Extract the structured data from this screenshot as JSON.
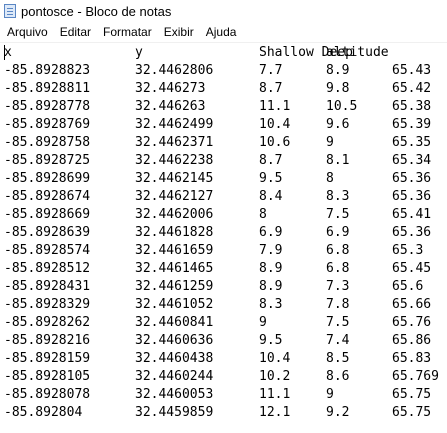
{
  "window": {
    "title": "pontosce - Bloco de notas",
    "icon": "notepad-icon"
  },
  "menu": [
    "Arquivo",
    "Editar",
    "Formatar",
    "Exibir",
    "Ajuda"
  ],
  "lines": [
    [
      "x",
      "y",
      "Shallow Deep",
      "altitude",
      ""
    ],
    [
      "-85.8928823",
      "32.4462806",
      "7.7",
      "8.9",
      "65.43"
    ],
    [
      "-85.8928811",
      "32.446273",
      "8.7",
      "9.8",
      "65.42"
    ],
    [
      "-85.8928778",
      "32.446263",
      "11.1",
      "10.5",
      "65.38"
    ],
    [
      "-85.8928769",
      "32.4462499",
      "10.4",
      "9.6",
      "65.39"
    ],
    [
      "-85.8928758",
      "32.4462371",
      "10.6",
      "9",
      "65.35"
    ],
    [
      "-85.8928725",
      "32.4462238",
      "8.7",
      "8.1",
      "65.34"
    ],
    [
      "-85.8928699",
      "32.4462145",
      "9.5",
      "8",
      "65.36"
    ],
    [
      "-85.8928674",
      "32.4462127",
      "8.4",
      "8.3",
      "65.36"
    ],
    [
      "-85.8928669",
      "32.4462006",
      "8",
      "7.5",
      "65.41"
    ],
    [
      "-85.8928639",
      "32.4461828",
      "6.9",
      "6.9",
      "65.36"
    ],
    [
      "-85.8928574",
      "32.4461659",
      "7.9",
      "6.8",
      "65.3"
    ],
    [
      "-85.8928512",
      "32.4461465",
      "8.9",
      "6.8",
      "65.45"
    ],
    [
      "-85.8928431",
      "32.4461259",
      "8.9",
      "7.3",
      "65.6"
    ],
    [
      "-85.8928329",
      "32.4461052",
      "8.3",
      "7.8",
      "65.66"
    ],
    [
      "-85.8928262",
      "32.4460841",
      "9",
      "7.5",
      "65.76"
    ],
    [
      "-85.8928216",
      "32.4460636",
      "9.5",
      "7.4",
      "65.86"
    ],
    [
      "-85.8928159",
      "32.4460438",
      "10.4",
      "8.5",
      "65.83"
    ],
    [
      "-85.8928105",
      "32.4460244",
      "10.2",
      "8.6",
      "65.769"
    ],
    [
      "-85.8928078",
      "32.4460053",
      "11.1",
      "9",
      "65.75"
    ],
    [
      "-85.892804",
      "32.4459859",
      "12.1",
      "9.2",
      "65.75"
    ]
  ]
}
